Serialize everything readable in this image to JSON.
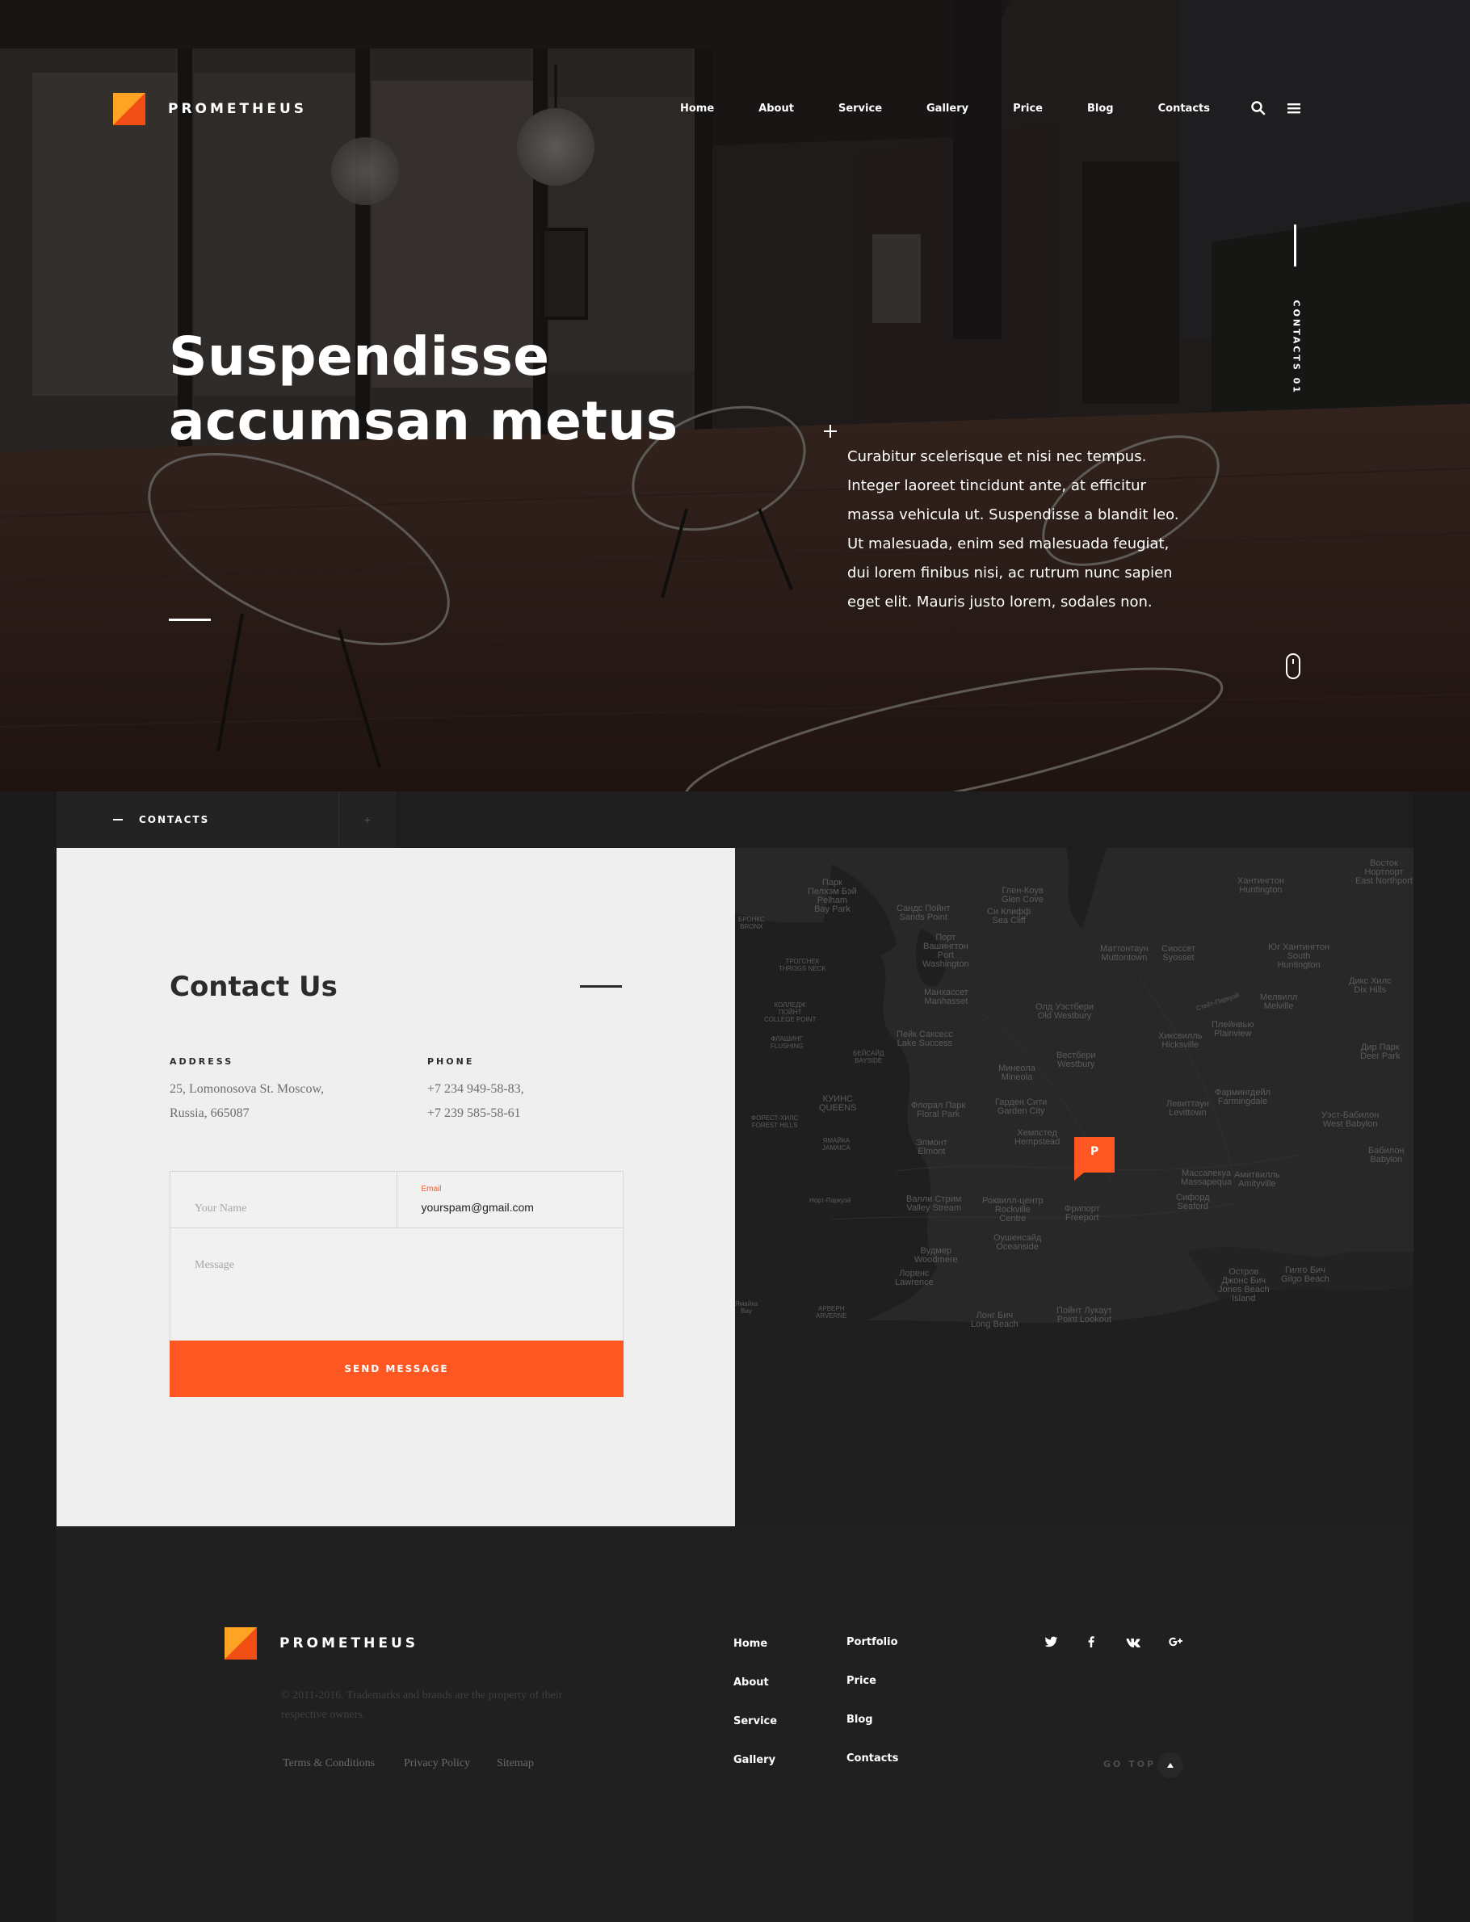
{
  "brand": {
    "name": "PROMETHEUS"
  },
  "nav": {
    "items": [
      "Home",
      "About",
      "Service",
      "Gallery",
      "Price",
      "Blog",
      "Contacts"
    ]
  },
  "header_icons": [
    "search-icon",
    "menu-icon"
  ],
  "hero": {
    "title_line1": "Suspendisse",
    "title_line2": "accumsan metus",
    "description": "Curabitur scelerisque et nisi nec tempus. Integer laoreet tincidunt ante, at efficitur massa vehicula ut. Suspendisse a blandit leo. Ut malesuada, enim sed malesuada feugiat, dui lorem finibus nisi, ac rutrum nunc sapien eget elit. Mauris justo lorem, sodales non.",
    "side_label": "CONTACTS 01"
  },
  "tabs": {
    "active_label": "CONTACTS",
    "extra": "+"
  },
  "contact": {
    "title": "Contact Us",
    "address_heading": "ADDRESS",
    "address_lines": [
      "25, Lomonosova St. Moscow,",
      "Russia, 665087"
    ],
    "phone_heading": "PHONE",
    "phone_lines": [
      "+7 234 949-58-83,",
      "+7 239 585-58-61"
    ],
    "form": {
      "name_placeholder": "Your Name",
      "email_label": "Email",
      "email_value": "yourspam@gmail.com",
      "message_placeholder": "Message",
      "submit_label": "SEND MESSAGE"
    }
  },
  "map": {
    "pin_label": "P",
    "labels": [
      "Парк\nПелхэм Бэй\nPelham\nBay Park",
      "Сандс Пойнт\nSands Point",
      "Глен-Коув\nGlen Cove",
      "Си Клифф\nSea Cliff",
      "Хантингтон\nHuntington",
      "Восток\nНортпорт\nEast Northport",
      "БРОНКС\nBRONX",
      "Порт\nВашингтон\nPort\nWashington",
      "Маттонтаун\nMuttontown",
      "Сиоссет\nSyosset",
      "Юг Хантингтон\nSouth\nHuntington",
      "ТРОГСНЕК\nTHROGS NECK",
      "Манхассет\nManhasset",
      "Олд Уэстбери\nOld Westbury",
      "Мелвилл\nMelville",
      "Дикс Хилс\nDix Hills",
      "КОЛЛЕДЖ\nПОЙНТ\nCOLLEGE POINT",
      "Пейк Саксесс\nLake Success",
      "Хиксвилль\nHicksville",
      "Плейнвью\nPlainview",
      "ФЛАШИНГ\nFLUSHING",
      "БЕЙСАЙД\nBAYSIDE",
      "Минеола\nMineola",
      "Вестбери\nWestbury",
      "Дир Парк\nDeer Park",
      "КУИНС\nQUEENS",
      "Флорал Парк\nFloral Park",
      "Гарден Сити\nGarden City",
      "Левиттаун\nLevittown",
      "Фармингдейл\nFarmingdale",
      "Уэст-Бабилон\nWest Babylon",
      "ФОРЕСТ-ХИЛС\nFOREST HILLS",
      "ЯМАЙКА\nJAMAICA",
      "Элмонт\nElmont",
      "Хемпстед\nHempstead",
      "Массапекуа\nMassapequa",
      "Амитвилль\nAmityville",
      "Бабилон\nBabylon",
      "Сифорд\nSeaford",
      "Валли Стрим\nValley Stream",
      "Роквилл-центр\nRockville\nCentre",
      "Фрипорт\nFreeport",
      "Вудмер\nWoodmere",
      "Оушенсайд\nOceanside",
      "Лоренс\nLawrence",
      "Остров\nДжонс Бич\nJones Beach\nIsland",
      "Гилго Бич\nGilgo Beach",
      "АРВЕРН\nARVERNE",
      "Лонг Бич\nLong Beach",
      "Пойнт Лукаут\nPoint Lookout",
      "Ямайка\nBay",
      "Норт-Паркуэй",
      "Стейт-Паркуэй"
    ]
  },
  "footer": {
    "copyright": "© 2011-2016. Trademarks and brands are the property of their respective owners.",
    "legal_links": [
      "Terms & Conditions",
      "Privacy Policy",
      "Sitemap"
    ],
    "links_col1": [
      "Home",
      "About",
      "Service",
      "Gallery"
    ],
    "links_col2": [
      "Portfolio",
      "Price",
      "Blog",
      "Contacts"
    ],
    "social": [
      "twitter-icon",
      "facebook-icon",
      "vk-icon",
      "google-plus-icon"
    ],
    "go_top": "GO TOP"
  },
  "colors": {
    "accent": "#ff5722",
    "logo_light": "#ffa324",
    "dark_bg": "#1b1b1c",
    "panel_bg": "#efefef"
  }
}
